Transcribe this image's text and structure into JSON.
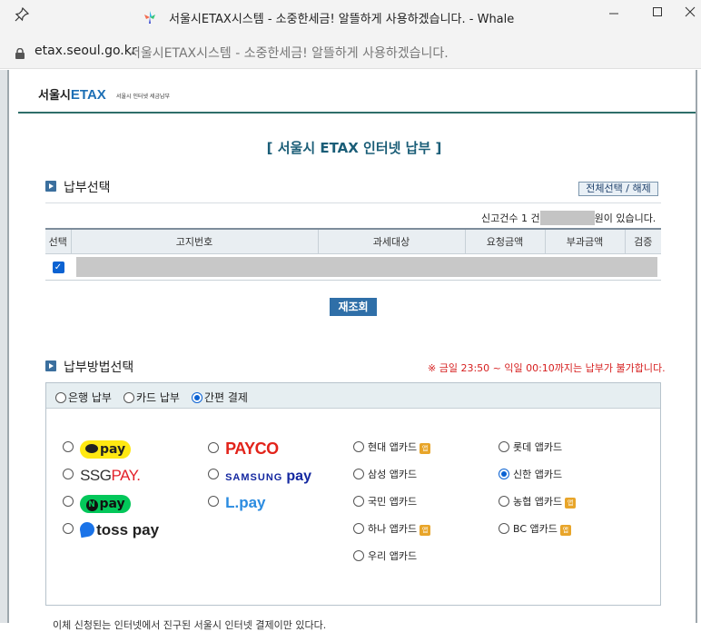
{
  "window": {
    "title": "서울시ETAX시스템 - 소중한세금! 알뜰하게 사용하겠습니다. - Whale",
    "controls": [
      "minimize-icon",
      "maximize-icon",
      "close-icon"
    ]
  },
  "address_bar": {
    "domain": "etax.seoul.go.kr",
    "page_title": "서울시ETAX시스템 - 소중한세금! 알뜰하게 사용하겠습니다."
  },
  "logo": {
    "prefix": "서울시",
    "brand": "ETAX",
    "subtitle": "서울시 인터넷 세금납부"
  },
  "page": {
    "title": "[ 서울시 ETAX 인터넷 납부 ]"
  },
  "payment_select": {
    "section_title": "납부선택",
    "select_all_button": "전체선택 / 해제",
    "count_prefix": "신고건수 1 건",
    "count_suffix": "원이 있습니다.",
    "table": {
      "headers": [
        "선택",
        "고지번호",
        "과세대상",
        "요청금액",
        "부과금액",
        "검증"
      ],
      "rows": [
        {
          "checked": true
        }
      ]
    },
    "reload_button": "재조회"
  },
  "payment_method": {
    "section_title": "납부방법선택",
    "notice": "※ 금일 23:50 ~ 익일 00:10까지는 납부가 불가합니다.",
    "tabs": [
      {
        "label": "은행 납부",
        "selected": false
      },
      {
        "label": "카드 납부",
        "selected": false
      },
      {
        "label": "간편 결제",
        "selected": true
      }
    ],
    "easy_pay": {
      "kakaopay_label": "pay",
      "payco_label": "PAYCO",
      "ssgpay_label": "SSG",
      "ssgpay_suffix": "PAY.",
      "samsungpay_label": "SAMSUNG",
      "samsungpay_suffix": "pay",
      "naverpay_badge": "N",
      "naverpay_label": "pay",
      "lpay_label": "L.pay",
      "tosspay_label": "toss pay"
    },
    "app_cards": [
      {
        "label": "현대 앱카드",
        "selected": false,
        "app_icon": true
      },
      {
        "label": "롯데 앱카드",
        "selected": false,
        "app_icon": false
      },
      {
        "label": "삼성 앱카드",
        "selected": false,
        "app_icon": false
      },
      {
        "label": "신한 앱카드",
        "selected": true,
        "app_icon": false
      },
      {
        "label": "국민 앱카드",
        "selected": false,
        "app_icon": false
      },
      {
        "label": "농협 앱카드",
        "selected": false,
        "app_icon": true
      },
      {
        "label": "하나 앱카드",
        "selected": false,
        "app_icon": true
      },
      {
        "label": "BC 앱카드",
        "selected": false,
        "app_icon": true
      },
      {
        "label": "우리 앱카드",
        "selected": false,
        "app_icon": false
      }
    ],
    "app_icon_text": "앱"
  },
  "footer": {
    "partial_note": "이체 신청된는 인터넷에서 진구된 서울시 인터넷 결제이만 있다다."
  }
}
